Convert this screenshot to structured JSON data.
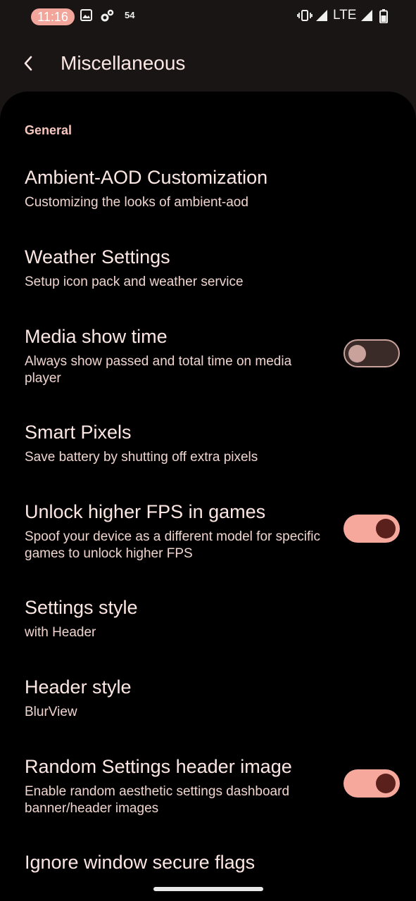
{
  "status_bar": {
    "time": "11:16",
    "notification_count": "54",
    "network": "LTE",
    "icons": [
      "gallery-icon",
      "settings-gear-icon",
      "vibrate-icon",
      "signal-icon",
      "battery-icon"
    ]
  },
  "toolbar": {
    "title": "Miscellaneous"
  },
  "section": {
    "header": "General"
  },
  "prefs": [
    {
      "title": "Ambient-AOD Customization",
      "summary": "Customizing the looks of ambient-aod"
    },
    {
      "title": "Weather Settings",
      "summary": "Setup icon pack and weather service"
    },
    {
      "title": "Media show time",
      "summary": "Always show passed and total time on media player",
      "toggle": "off"
    },
    {
      "title": "Smart Pixels",
      "summary": "Save battery by shutting off extra pixels"
    },
    {
      "title": "Unlock higher FPS in games",
      "summary": "Spoof your device as a different model for specific games to unlock higher FPS",
      "toggle": "on"
    },
    {
      "title": "Settings style",
      "summary": "with Header"
    },
    {
      "title": "Header style",
      "summary": "BlurView"
    },
    {
      "title": "Random Settings header image",
      "summary": "Enable random aesthetic settings dashboard banner/header images",
      "toggle": "on"
    },
    {
      "title": "Ignore window secure flags"
    }
  ],
  "colors": {
    "accent": "#f7a89c",
    "toggle_knob_on": "#5a201b",
    "background": "#000000"
  }
}
